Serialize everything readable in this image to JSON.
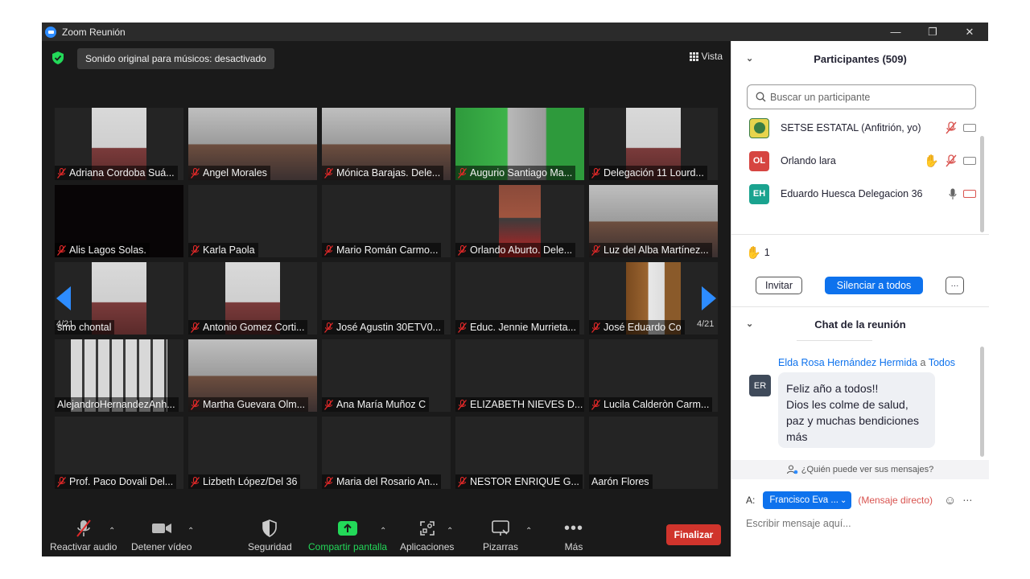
{
  "window": {
    "title": "Zoom Reunión"
  },
  "video_header": {
    "sound_badge": "Sonido original para músicos: desactivado",
    "view_label": "Vista"
  },
  "pagination": {
    "left": "4/21",
    "right": "4/21"
  },
  "tiles": [
    {
      "name": "Adriana Cordoba Suá...",
      "muted": true,
      "video": "person"
    },
    {
      "name": "Angel Morales",
      "muted": true,
      "video": "person-wide"
    },
    {
      "name": "Mónica Barajas. Dele...",
      "muted": true,
      "video": "person-wide"
    },
    {
      "name": "Augurio Santiago Ma...",
      "muted": true,
      "video": "green"
    },
    {
      "name": "Delegación 11 Lourd...",
      "muted": true,
      "video": "person"
    },
    {
      "name": "Alis Lagos Solas.",
      "muted": true,
      "video": "black"
    },
    {
      "name": "Karla Paola",
      "muted": true,
      "video": "none"
    },
    {
      "name": "Mario Román Carmo...",
      "muted": true,
      "video": "none"
    },
    {
      "name": "Orlando Aburto. Dele...",
      "muted": true,
      "video": "person-brick"
    },
    {
      "name": "Luz del Alba Martínez...",
      "muted": true,
      "video": "person-wide"
    },
    {
      "name": "smo chontal",
      "muted": false,
      "video": "person"
    },
    {
      "name": "Antonio Gomez Corti...",
      "muted": true,
      "video": "person"
    },
    {
      "name": "José Agustin 30ETV0...",
      "muted": true,
      "video": "none"
    },
    {
      "name": "Educ. Jennie Murrieta...",
      "muted": true,
      "video": "none"
    },
    {
      "name": "José Eduardo Co",
      "muted": true,
      "video": "person-wood"
    },
    {
      "name": "AlejandroHernandezAnh...",
      "muted": false,
      "video": "room"
    },
    {
      "name": "Martha Guevara Olm...",
      "muted": true,
      "video": "person-wide"
    },
    {
      "name": "Ana María Muñoz C",
      "muted": true,
      "video": "none"
    },
    {
      "name": "ELIZABETH NIEVES D...",
      "muted": true,
      "video": "none"
    },
    {
      "name": "Lucila Calderòn Carm...",
      "muted": true,
      "video": "none"
    },
    {
      "name": "Prof. Paco Dovali Del...",
      "muted": true,
      "video": "none"
    },
    {
      "name": "Lizbeth López/Del 36",
      "muted": true,
      "video": "none"
    },
    {
      "name": "Maria del Rosario An...",
      "muted": true,
      "video": "none"
    },
    {
      "name": "NESTOR ENRIQUE G...",
      "muted": true,
      "video": "none"
    },
    {
      "name": "Aarón Flores",
      "muted": false,
      "video": "none"
    }
  ],
  "toolbar": {
    "audio": "Reactivar audio",
    "video": "Detener vídeo",
    "security": "Seguridad",
    "share": "Compartir pantalla",
    "apps": "Aplicaciones",
    "whiteboards": "Pizarras",
    "more": "Más",
    "end": "Finalizar"
  },
  "participants": {
    "header": "Participantes (509)",
    "search_placeholder": "Buscar un participante",
    "rows": [
      {
        "initials": "",
        "name": "SETSE ESTATAL (Anfitrión, yo)",
        "color": "#e8d44d"
      },
      {
        "initials": "OL",
        "name": "Orlando lara",
        "color": "#d64541"
      },
      {
        "initials": "EH",
        "name": "Eduardo Huesca Delegacion  36",
        "color": "#1aa38f"
      }
    ],
    "raised_hands": "1",
    "invite": "Invitar",
    "mute_all": "Silenciar a todos",
    "more": "···"
  },
  "chat": {
    "header": "Chat de la reunión",
    "sender": "Elda Rosa Hernández Hermida",
    "sender_joiner": "a",
    "recipient": "Todos",
    "avatar": "ER",
    "message_lines": [
      "Feliz año a todos!!",
      "Dios les colme de salud,",
      "paz y muchas bendiciones",
      "más"
    ],
    "who_can_see": "¿Quién puede ver sus mensajes?",
    "to_label": "A:",
    "to_value": "Francisco Eva ...",
    "direct": "(Mensaje directo)",
    "input_placeholder": "Escribir mensaje aquí..."
  }
}
